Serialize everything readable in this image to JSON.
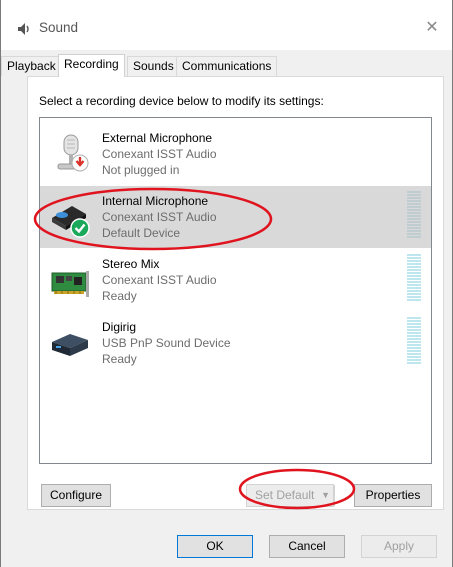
{
  "window": {
    "title": "Sound",
    "close_glyph": "✕",
    "title_icon": "speaker-icon"
  },
  "tabs": [
    {
      "label": "Playback",
      "active": false
    },
    {
      "label": "Recording",
      "active": true
    },
    {
      "label": "Sounds",
      "active": false
    },
    {
      "label": "Communications",
      "active": false
    }
  ],
  "panel": {
    "instruction": "Select a recording device below to modify its settings:"
  },
  "devices": [
    {
      "name": "External Microphone",
      "driver": "Conexant ISST Audio",
      "status": "Not plugged in",
      "icon": "microphone-icon",
      "badge": "unplugged-badge-icon",
      "selected": false
    },
    {
      "name": "Internal Microphone",
      "driver": "Conexant ISST Audio",
      "status": "Default Device",
      "icon": "internal-microphone-icon",
      "badge": "default-check-badge-icon",
      "selected": true
    },
    {
      "name": "Stereo Mix",
      "driver": "Conexant ISST Audio",
      "status": "Ready",
      "icon": "sound-card-icon",
      "badge": "",
      "selected": false
    },
    {
      "name": "Digirig",
      "driver": "USB PnP Sound Device",
      "status": "Ready",
      "icon": "usb-sound-device-icon",
      "badge": "",
      "selected": false
    }
  ],
  "buttons": {
    "configure": "Configure",
    "set_default": "Set Default",
    "properties": "Properties",
    "ok": "OK",
    "cancel": "Cancel",
    "apply": "Apply"
  },
  "colors": {
    "annotation_red": "#e0141e",
    "default_badge_green": "#1aa85a",
    "unplugged_badge_red": "#d9322b",
    "selection_gray": "#d9d9d9"
  }
}
